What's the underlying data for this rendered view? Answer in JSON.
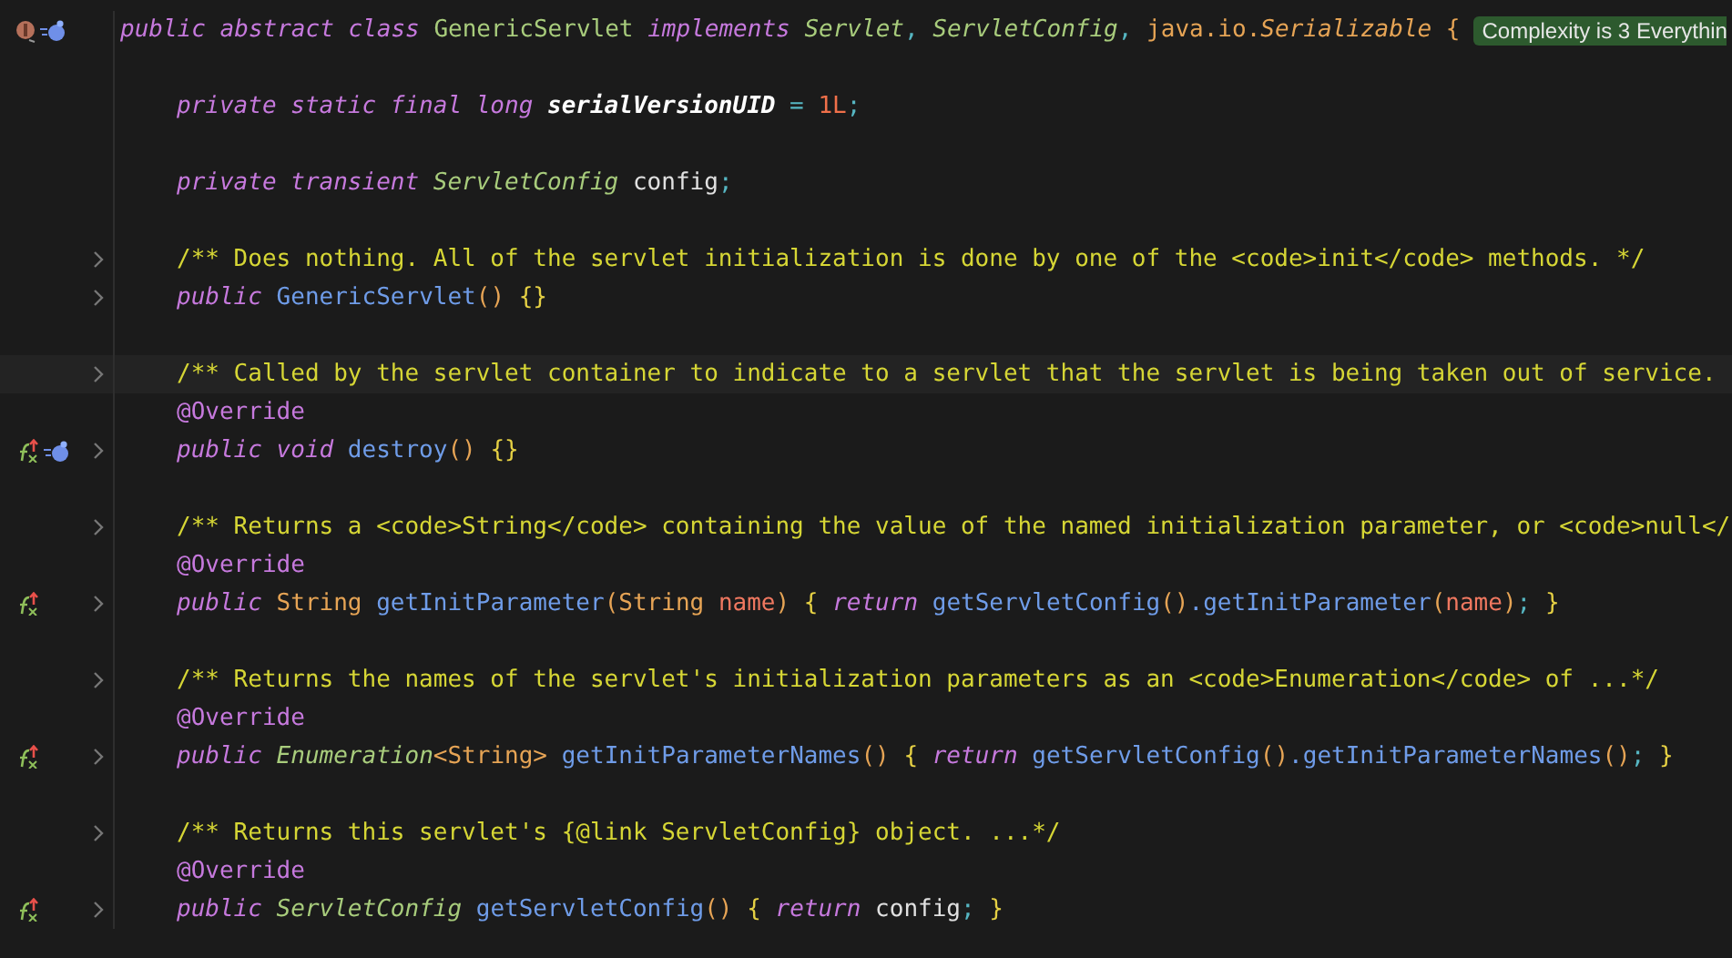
{
  "lines": [
    {
      "kind": "code",
      "indented": false,
      "foldable": false,
      "current": false,
      "class_marker": true,
      "bean": true,
      "tokens": [
        {
          "kind": "kw",
          "text": "public abstract class "
        },
        {
          "kind": "class",
          "text": "GenericServlet "
        },
        {
          "kind": "kw",
          "text": "implements "
        },
        {
          "kind": "type",
          "text": "Servlet"
        },
        {
          "kind": "punct",
          "text": ", "
        },
        {
          "kind": "type",
          "text": "ServletConfig"
        },
        {
          "kind": "punct",
          "text": ", "
        },
        {
          "kind": "lib",
          "text": "java.io."
        },
        {
          "kind": "libi",
          "text": "Serializable "
        },
        {
          "kind": "paren",
          "text": "{"
        }
      ],
      "badge": "Complexity is 3 Everythin"
    },
    {
      "kind": "blank"
    },
    {
      "kind": "code",
      "indented": true,
      "foldable": false,
      "current": false,
      "tokens": [
        {
          "kind": "kw",
          "text": "private static final long "
        },
        {
          "kind": "field",
          "text": "serialVersionUID"
        },
        {
          "kind": "punct",
          "text": " = "
        },
        {
          "kind": "number",
          "text": "1L"
        },
        {
          "kind": "punct",
          "text": ";"
        }
      ]
    },
    {
      "kind": "blank"
    },
    {
      "kind": "code",
      "indented": true,
      "foldable": false,
      "current": false,
      "tokens": [
        {
          "kind": "kw",
          "text": "private transient "
        },
        {
          "kind": "type",
          "text": "ServletConfig "
        },
        {
          "kind": "plain",
          "text": "config"
        },
        {
          "kind": "punct",
          "text": ";"
        }
      ]
    },
    {
      "kind": "blank"
    },
    {
      "kind": "code",
      "indented": true,
      "foldable": true,
      "current": false,
      "tokens": [
        {
          "kind": "comment",
          "text": "/** Does nothing. All of the servlet initialization is done by one of the <code>init</code> methods. */"
        }
      ]
    },
    {
      "kind": "code",
      "indented": true,
      "foldable": true,
      "current": false,
      "tokens": [
        {
          "kind": "kw",
          "text": "public "
        },
        {
          "kind": "method",
          "text": "GenericServlet"
        },
        {
          "kind": "paren",
          "text": "() "
        },
        {
          "kind": "brace",
          "text": "{}"
        }
      ]
    },
    {
      "kind": "blank"
    },
    {
      "kind": "code",
      "indented": true,
      "foldable": true,
      "current": true,
      "tokens": [
        {
          "kind": "comment",
          "text": "/** Called by the servlet container to indicate to a servlet that the servlet is being taken out of service."
        }
      ]
    },
    {
      "kind": "code",
      "indented": true,
      "foldable": false,
      "current": false,
      "tokens": [
        {
          "kind": "annotation",
          "text": "@Override"
        }
      ]
    },
    {
      "kind": "code",
      "indented": true,
      "foldable": true,
      "current": false,
      "overrides": true,
      "bean": true,
      "tokens": [
        {
          "kind": "kw",
          "text": "public void "
        },
        {
          "kind": "method",
          "text": "destroy"
        },
        {
          "kind": "paren",
          "text": "() "
        },
        {
          "kind": "brace",
          "text": "{}"
        }
      ]
    },
    {
      "kind": "blank"
    },
    {
      "kind": "code",
      "indented": true,
      "foldable": true,
      "current": false,
      "tokens": [
        {
          "kind": "comment",
          "text": "/** Returns a <code>String</code> containing the value of the named initialization parameter, or <code>null</"
        }
      ]
    },
    {
      "kind": "code",
      "indented": true,
      "foldable": false,
      "current": false,
      "tokens": [
        {
          "kind": "annotation",
          "text": "@Override"
        }
      ]
    },
    {
      "kind": "code",
      "indented": true,
      "foldable": true,
      "current": false,
      "overrides": true,
      "tokens": [
        {
          "kind": "kw",
          "text": "public "
        },
        {
          "kind": "lib",
          "text": "String "
        },
        {
          "kind": "method",
          "text": "getInitParameter"
        },
        {
          "kind": "paren",
          "text": "("
        },
        {
          "kind": "lib",
          "text": "String "
        },
        {
          "kind": "param",
          "text": "name"
        },
        {
          "kind": "paren",
          "text": ") "
        },
        {
          "kind": "brace",
          "text": "{ "
        },
        {
          "kind": "kw",
          "text": "return "
        },
        {
          "kind": "method",
          "text": "getServletConfig"
        },
        {
          "kind": "paren",
          "text": "()"
        },
        {
          "kind": "method",
          "text": ".getInitParameter"
        },
        {
          "kind": "paren",
          "text": "("
        },
        {
          "kind": "param",
          "text": "name"
        },
        {
          "kind": "paren",
          "text": ")"
        },
        {
          "kind": "punct",
          "text": "; "
        },
        {
          "kind": "brace",
          "text": "}"
        }
      ]
    },
    {
      "kind": "blank"
    },
    {
      "kind": "code",
      "indented": true,
      "foldable": true,
      "current": false,
      "tokens": [
        {
          "kind": "comment",
          "text": "/** Returns the names of the servlet's initialization parameters as an <code>Enumeration</code> of ...*/"
        }
      ]
    },
    {
      "kind": "code",
      "indented": true,
      "foldable": false,
      "current": false,
      "tokens": [
        {
          "kind": "annotation",
          "text": "@Override"
        }
      ]
    },
    {
      "kind": "code",
      "indented": true,
      "foldable": true,
      "current": false,
      "overrides": true,
      "tokens": [
        {
          "kind": "kw",
          "text": "public "
        },
        {
          "kind": "type",
          "text": "Enumeration"
        },
        {
          "kind": "lib",
          "text": "<String> "
        },
        {
          "kind": "method",
          "text": "getInitParameterNames"
        },
        {
          "kind": "paren",
          "text": "() "
        },
        {
          "kind": "brace",
          "text": "{ "
        },
        {
          "kind": "kw",
          "text": "return "
        },
        {
          "kind": "method",
          "text": "getServletConfig"
        },
        {
          "kind": "paren",
          "text": "()"
        },
        {
          "kind": "method",
          "text": ".getInitParameterNames"
        },
        {
          "kind": "paren",
          "text": "()"
        },
        {
          "kind": "punct",
          "text": "; "
        },
        {
          "kind": "brace",
          "text": "}"
        }
      ]
    },
    {
      "kind": "blank"
    },
    {
      "kind": "code",
      "indented": true,
      "foldable": true,
      "current": false,
      "tokens": [
        {
          "kind": "comment",
          "text": "/** Returns this servlet's {@link ServletConfig} object. ...*/"
        }
      ]
    },
    {
      "kind": "code",
      "indented": true,
      "foldable": false,
      "current": false,
      "tokens": [
        {
          "kind": "annotation",
          "text": "@Override"
        }
      ]
    },
    {
      "kind": "code",
      "indented": true,
      "foldable": true,
      "current": false,
      "overrides": true,
      "tokens": [
        {
          "kind": "kw",
          "text": "public "
        },
        {
          "kind": "type",
          "text": "ServletConfig "
        },
        {
          "kind": "method",
          "text": "getServletConfig"
        },
        {
          "kind": "paren",
          "text": "() "
        },
        {
          "kind": "brace",
          "text": "{ "
        },
        {
          "kind": "kw",
          "text": "return "
        },
        {
          "kind": "plain",
          "text": "config"
        },
        {
          "kind": "punct",
          "text": "; "
        },
        {
          "kind": "brace",
          "text": "}"
        }
      ]
    }
  ]
}
